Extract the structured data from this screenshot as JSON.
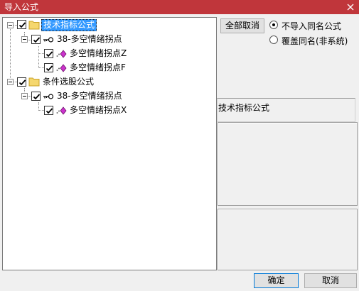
{
  "window": {
    "title": "导入公式"
  },
  "tree": {
    "groups": [
      {
        "label": "技术指标公式",
        "checked": true,
        "selected": true,
        "formula": {
          "label": "38-多空情绪拐点",
          "checked": true,
          "items": [
            {
              "label": "多空情绪拐点Z",
              "checked": true
            },
            {
              "label": "多空情绪拐点F",
              "checked": true
            }
          ]
        }
      },
      {
        "label": "条件选股公式",
        "checked": true,
        "selected": false,
        "formula": {
          "label": "38-多空情绪拐点",
          "checked": true,
          "items": [
            {
              "label": "多空情绪拐点X",
              "checked": true
            }
          ]
        }
      }
    ]
  },
  "options": {
    "deselect_all_label": "全部取消",
    "radio_no_import_label": "不导入同名公式",
    "radio_overwrite_label": "覆盖同名(非系统)",
    "selected": "no_import"
  },
  "info": {
    "type_label": "技术指标公式"
  },
  "footer": {
    "ok_label": "确定",
    "cancel_label": "取消"
  },
  "colors": {
    "titlebar": "#c0363b",
    "selection": "#3399ff",
    "folder": "#f5d76e",
    "leaf_icon": "#cc33cc"
  }
}
